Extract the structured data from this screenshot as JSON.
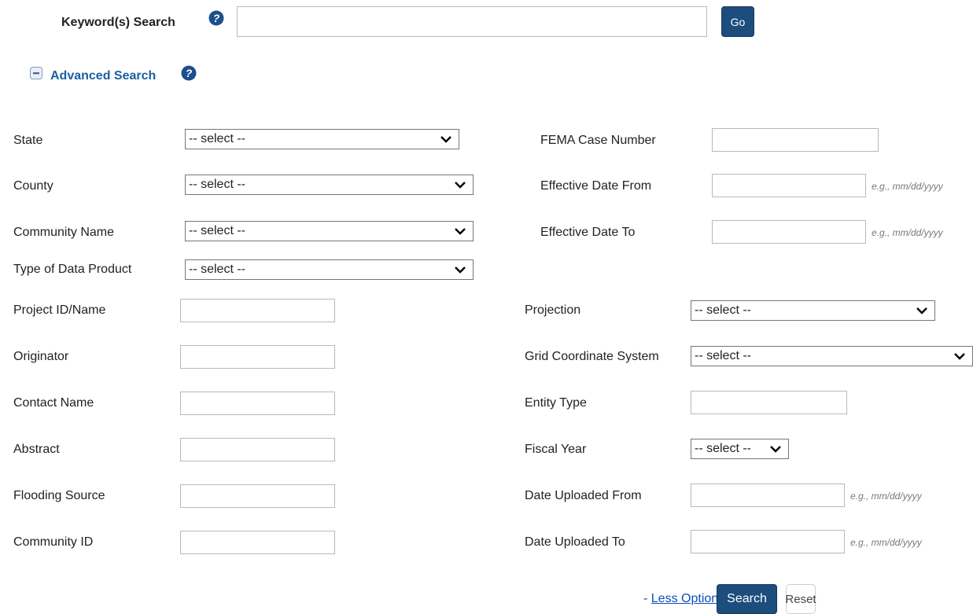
{
  "keyword": {
    "label": "Keyword(s) Search",
    "value": "",
    "go_label": "Go"
  },
  "advanced": {
    "label": "Advanced Search"
  },
  "fields": {
    "state": {
      "label": "State",
      "value": "-- select --"
    },
    "county": {
      "label": "County",
      "value": "-- select --"
    },
    "community_name": {
      "label": "Community Name",
      "value": "-- select --"
    },
    "data_product": {
      "label": "Type of Data Product",
      "value": "-- select --"
    },
    "fema_case": {
      "label": "FEMA Case Number",
      "value": ""
    },
    "eff_from": {
      "label": "Effective Date From",
      "value": "",
      "hint": "e.g., mm/dd/yyyy"
    },
    "eff_to": {
      "label": "Effective Date To",
      "value": "",
      "hint": "e.g., mm/dd/yyyy"
    },
    "project": {
      "label": "Project ID/Name",
      "value": ""
    },
    "originator": {
      "label": "Originator",
      "value": ""
    },
    "contact": {
      "label": "Contact Name",
      "value": ""
    },
    "abstract": {
      "label": "Abstract",
      "value": ""
    },
    "flooding": {
      "label": "Flooding Source",
      "value": ""
    },
    "community_id": {
      "label": "Community ID",
      "value": ""
    },
    "projection": {
      "label": "Projection",
      "value": "-- select --"
    },
    "grid": {
      "label": "Grid Coordinate System",
      "value": "-- select --"
    },
    "entity": {
      "label": "Entity Type",
      "value": ""
    },
    "fiscal": {
      "label": "Fiscal Year",
      "value": "-- select --"
    },
    "up_from": {
      "label": "Date Uploaded From",
      "value": "",
      "hint": "e.g., mm/dd/yyyy"
    },
    "up_to": {
      "label": "Date Uploaded To",
      "value": "",
      "hint": "e.g., mm/dd/yyyy"
    }
  },
  "footer": {
    "dash": "- ",
    "less_options": "Less Options",
    "search": "Search",
    "reset": "Reset"
  },
  "colors": {
    "button_blue": "#1d4d7d",
    "link_blue": "#0b4ec0",
    "heading_blue": "#1a5fa3"
  }
}
